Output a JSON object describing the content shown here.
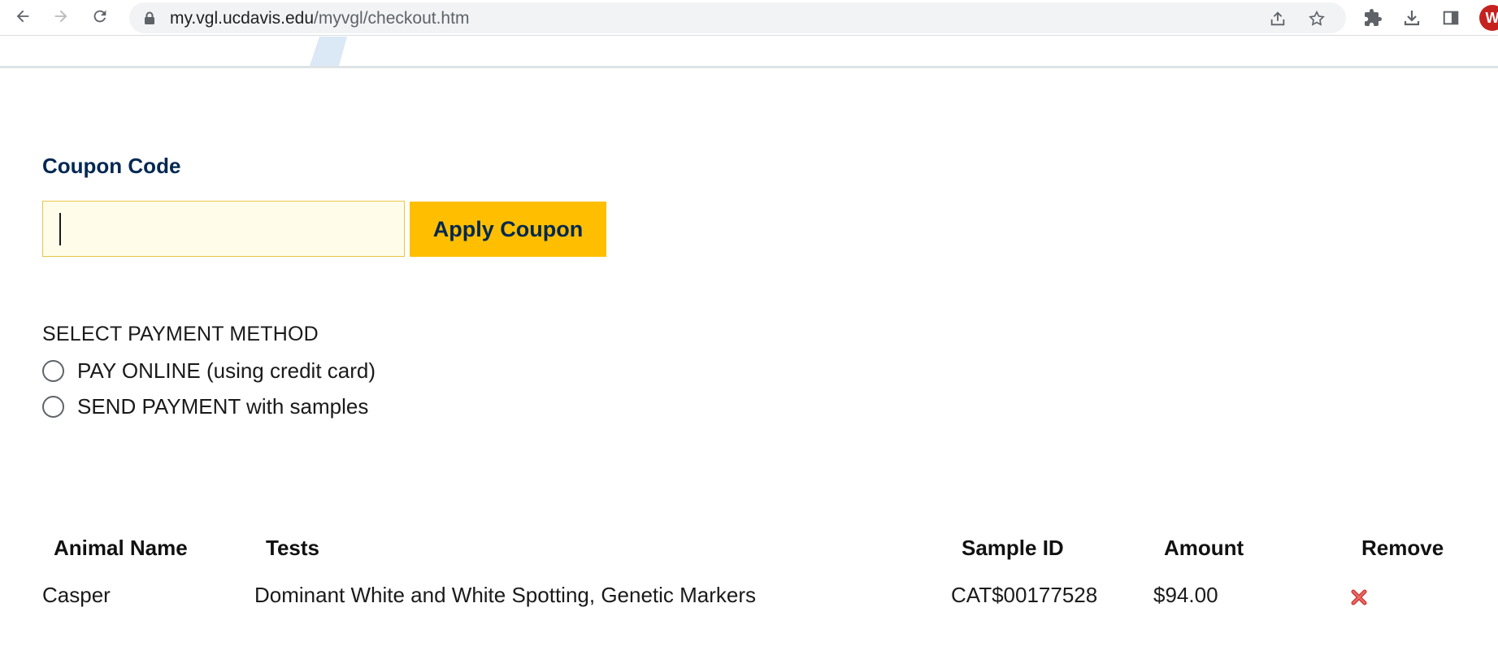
{
  "browser": {
    "url_host": "my.vgl.ucdavis.edu",
    "url_path": "/myvgl/checkout.htm",
    "profile_initial": "W",
    "icons": [
      "back-icon",
      "forward-icon",
      "reload-icon",
      "lock-icon",
      "share-icon",
      "bookmark-star-icon",
      "extensions-icon",
      "download-icon",
      "side-panel-icon"
    ]
  },
  "coupon": {
    "title": "Coupon Code",
    "input_value": "",
    "input_placeholder": "",
    "apply_label": "Apply Coupon"
  },
  "payment": {
    "title": "SELECT PAYMENT METHOD",
    "options": [
      {
        "label": "PAY ONLINE (using credit card)",
        "selected": false
      },
      {
        "label": "SEND PAYMENT with samples",
        "selected": false
      }
    ]
  },
  "table": {
    "headers": [
      "Animal Name",
      "Tests",
      "Sample ID",
      "Amount",
      "Remove"
    ],
    "rows": [
      {
        "animal_name": "Casper",
        "tests": "Dominant White and White Spotting, Genetic Markers",
        "sample_id": "CAT$00177528",
        "amount": "$94.00",
        "remove_icon": "remove-x-icon"
      }
    ]
  },
  "colors": {
    "brand_navy": "#022851",
    "accent_gold": "#ffbf00",
    "input_bg": "#fffdea",
    "remove_red": "#d9534f"
  }
}
